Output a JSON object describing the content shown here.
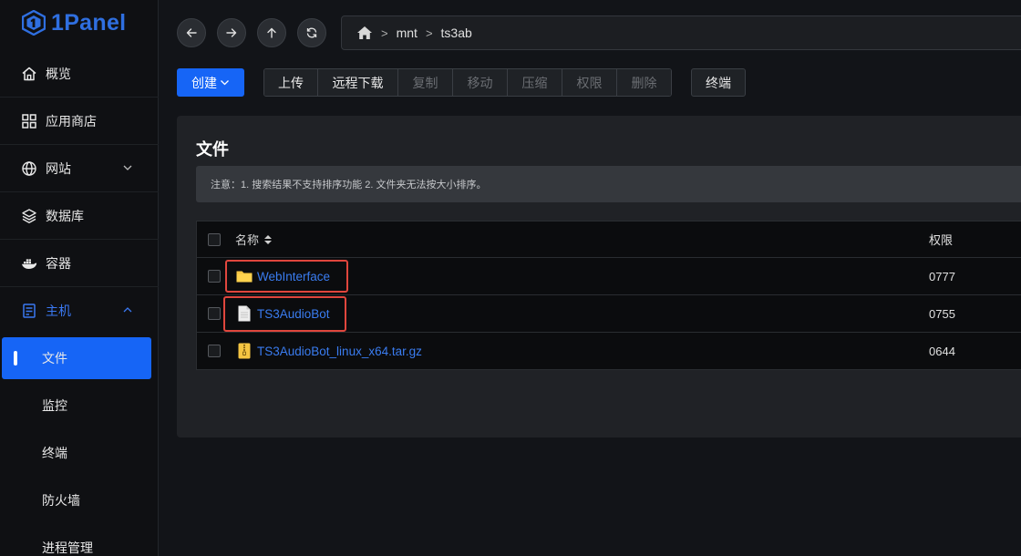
{
  "app": {
    "logo_text": "1Panel"
  },
  "sidebar": {
    "items": [
      {
        "label": "概览",
        "icon": "home-icon"
      },
      {
        "label": "应用商店",
        "icon": "grid-icon"
      },
      {
        "label": "网站",
        "icon": "globe-icon",
        "expandable": true
      },
      {
        "label": "数据库",
        "icon": "layers-icon"
      },
      {
        "label": "容器",
        "icon": "docker-icon"
      },
      {
        "label": "主机",
        "icon": "server-icon",
        "expanded": true
      }
    ],
    "sub_items": [
      {
        "label": "文件",
        "active": true
      },
      {
        "label": "监控"
      },
      {
        "label": "终端"
      },
      {
        "label": "防火墙"
      },
      {
        "label": "进程管理"
      }
    ]
  },
  "nav": {
    "breadcrumb": [
      "mnt",
      "ts3ab"
    ],
    "separator": ">"
  },
  "toolbar": {
    "create_label": "创建",
    "group": [
      {
        "label": "上传",
        "enabled": true
      },
      {
        "label": "远程下载",
        "enabled": true
      },
      {
        "label": "复制",
        "enabled": false
      },
      {
        "label": "移动",
        "enabled": false
      },
      {
        "label": "压缩",
        "enabled": false
      },
      {
        "label": "权限",
        "enabled": false
      },
      {
        "label": "删除",
        "enabled": false
      }
    ],
    "terminal_label": "终端"
  },
  "main": {
    "title": "文件",
    "notice": "注意：1. 搜索结果不支持排序功能 2. 文件夹无法按大小排序。",
    "table": {
      "columns": {
        "name": "名称",
        "permission": "权限"
      },
      "rows": [
        {
          "name": "WebInterface",
          "type": "folder",
          "permission": "0777",
          "highlighted": true
        },
        {
          "name": "TS3AudioBot",
          "type": "file",
          "permission": "0755",
          "highlighted": true
        },
        {
          "name": "TS3AudioBot_linux_x64.tar.gz",
          "type": "archive",
          "permission": "0644",
          "highlighted": false
        }
      ]
    }
  },
  "colors": {
    "accent": "#1665f6",
    "link": "#3a7cf0",
    "highlight_box": "#e0463d",
    "folder": "#f5c542"
  }
}
